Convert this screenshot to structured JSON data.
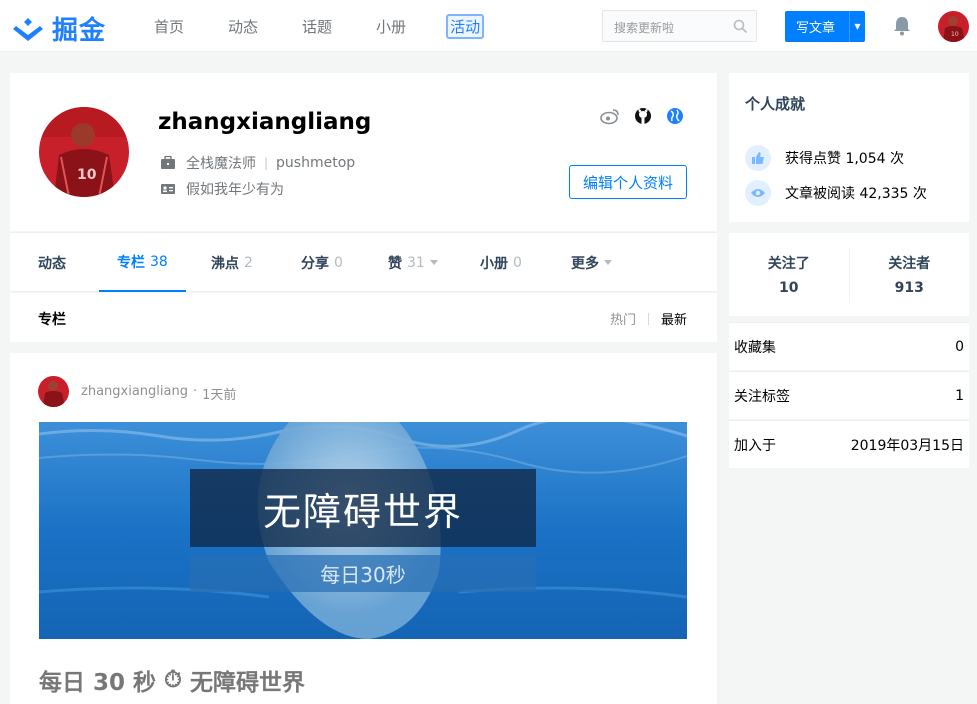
{
  "header": {
    "brand": "掘金",
    "nav": [
      "首页",
      "动态",
      "话题",
      "小册",
      "活动"
    ],
    "active_nav": "活动",
    "search_placeholder": "搜索更新啦",
    "write_label": "写文章"
  },
  "profile": {
    "username": "zhangxiangliang",
    "job_title": "全栈魔法师",
    "company": "pushmetop",
    "intro": "假如我年少有为",
    "edit_label": "编辑个人资料",
    "social_icons": [
      "weibo-icon",
      "github-icon",
      "homepage-icon"
    ]
  },
  "tabs": [
    {
      "label": "动态",
      "count": ""
    },
    {
      "label": "专栏",
      "count": "38"
    },
    {
      "label": "沸点",
      "count": "2"
    },
    {
      "label": "分享",
      "count": "0"
    },
    {
      "label": "赞",
      "count": "31"
    },
    {
      "label": "小册",
      "count": "0"
    },
    {
      "label": "更多",
      "count": ""
    }
  ],
  "section": {
    "title": "专栏",
    "sort_hot": "热门",
    "sort_new": "最新"
  },
  "entry": {
    "author": "zhangxiangliang",
    "time": "1天前",
    "cover_title": "无障碍世界",
    "cover_subtitle": "每日30秒",
    "title_prefix": "每日 30 秒",
    "title_emoji": "⏱",
    "title_suffix": "无障碍世界"
  },
  "sidebar": {
    "achievements_title": "个人成就",
    "likes_text": "获得点赞 1,054 次",
    "reads_text": "文章被阅读 42,335 次",
    "following_label": "关注了",
    "following_count": "10",
    "followers_label": "关注者",
    "followers_count": "913",
    "info": [
      {
        "label": "收藏集",
        "value": "0"
      },
      {
        "label": "关注标签",
        "value": "1"
      },
      {
        "label": "加入于",
        "value": "2019年03月15日"
      }
    ]
  },
  "colors": {
    "brand_blue": "#1e80ff",
    "button_blue": "#007fff"
  }
}
